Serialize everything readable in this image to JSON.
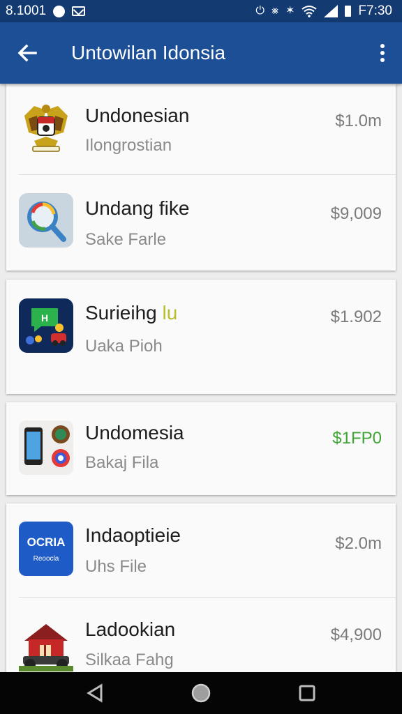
{
  "status_bar": {
    "left_text": "8.1001",
    "time": "F7:30",
    "icons": [
      "notification-icon",
      "mail-icon",
      "alarm-icon",
      "bluetooth-icon",
      "vibrate-icon",
      "wifi-icon",
      "signal-icon",
      "battery-icon"
    ]
  },
  "app_bar": {
    "title": "Untowilan Idonsia",
    "back_icon": "arrow-left-icon",
    "menu_icon": "more-vert-icon"
  },
  "items": [
    {
      "title": "Undonesian",
      "subtitle": "Ilongrostian",
      "price": "$1.0m",
      "icon": "garuda-emblem-icon"
    },
    {
      "title": "Undang fike",
      "subtitle": "Sake Farle",
      "price": "$9,009",
      "icon": "magnifier-icon"
    },
    {
      "title": "Surieihg ",
      "title_accent": "lu",
      "subtitle": "Uaka Pioh",
      "price": "$1.902",
      "icon": "game-app-icon"
    },
    {
      "title": "Undomesia",
      "subtitle": "Bakaj Fila",
      "price": "$1FP0",
      "price_color": "#3fa535",
      "icon": "phone-apps-icon"
    },
    {
      "title": "Indaoptieie",
      "subtitle": "Uhs File",
      "price": "$2.0m",
      "icon": "ocria-app-icon",
      "icon_text": "OCRIA",
      "icon_subtext": "Reoocla"
    },
    {
      "title": "Ladookian",
      "subtitle": "Silkaa Fahg",
      "price": "$4,900",
      "icon": "house-tractor-icon"
    }
  ],
  "nav_bar": {
    "icons": [
      "back-triangle-icon",
      "home-circle-icon",
      "recents-square-icon"
    ]
  },
  "colors": {
    "status_bar": "#143a72",
    "app_bar": "#1c4f96",
    "price_green": "#3fa535",
    "accent_yellow": "#b8bd2a"
  }
}
